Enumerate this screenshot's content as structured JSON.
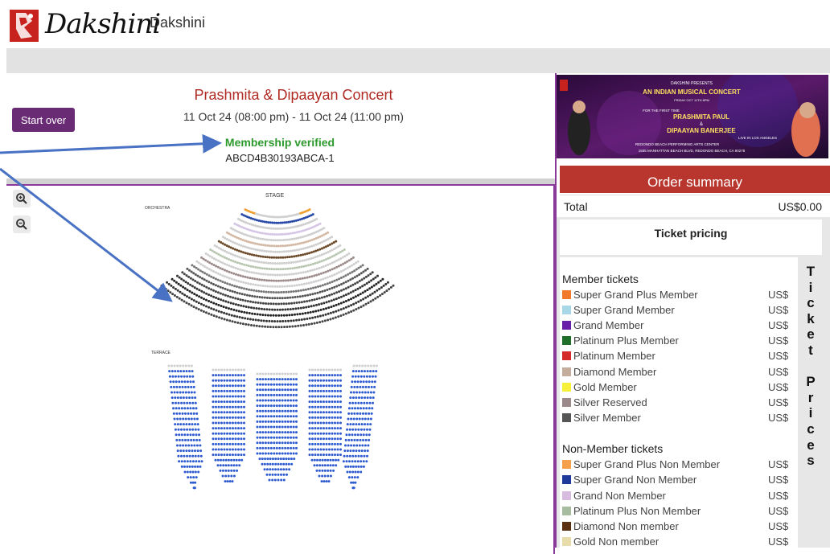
{
  "header": {
    "logo_word": "Dakshini",
    "site_name": "Dakshini"
  },
  "event": {
    "start_over_label": "Start over",
    "title": "Prashmita & Dipaayan Concert",
    "dates": "11 Oct 24 (08:00 pm) - 11 Oct 24 (11:00 pm)",
    "membership_status": "Membership verified",
    "membership_code": "ABCD4B30193ABCA-1"
  },
  "seatmap": {
    "stage_label": "STAGE",
    "orchestra_label": "ORCHESTRA",
    "terrace_label": "TERRACE",
    "icons": {
      "zoom_in": "zoom-in-icon",
      "zoom_out": "zoom-out-icon"
    }
  },
  "banner": {
    "presents": "DAKSHINI PRESENTS",
    "headline": "AN INDIAN MUSICAL CONCERT",
    "date_line": "FRIDAY OCT 11TH 8PM",
    "first_time": "FOR THE FIRST TIME",
    "artist1": "PRASHMITA PAUL",
    "amp": "&",
    "artist2": "DIPAAYAN BANERJEE",
    "live": "LIVE IN LOS ANGELES",
    "venue": "REDONDO BEACH PERFORMING ARTS CENTER",
    "address": "1935 MANHATTAN BEACH BLVD, REDONDO BEACH, CA 90278"
  },
  "summary": {
    "title": "Order summary",
    "total_label": "Total",
    "total_value": "US$0.00"
  },
  "pricing": {
    "title": "Ticket pricing",
    "vertical_label": [
      "T",
      "i",
      "c",
      "k",
      "e",
      "t",
      " ",
      "P",
      "r",
      "i",
      "c",
      "e",
      "s"
    ],
    "groups": [
      {
        "title": "Member tickets",
        "tiers": [
          {
            "name": "Super Grand Plus Member",
            "currency": "US$",
            "color": "#f07a2a"
          },
          {
            "name": "Super Grand Member",
            "currency": "US$",
            "color": "#a8d8e8"
          },
          {
            "name": "Grand Member",
            "currency": "US$",
            "color": "#6a1fa8"
          },
          {
            "name": "Platinum Plus Member",
            "currency": "US$",
            "color": "#1f6e2a"
          },
          {
            "name": "Platinum Member",
            "currency": "US$",
            "color": "#d42a2a"
          },
          {
            "name": "Diamond Member",
            "currency": "US$",
            "color": "#c4ad9c"
          },
          {
            "name": "Gold Member",
            "currency": "US$",
            "color": "#f7f03a"
          },
          {
            "name": "Silver Reserved",
            "currency": "US$",
            "color": "#9c8a8a"
          },
          {
            "name": "Silver Member",
            "currency": "US$",
            "color": "#555555"
          }
        ]
      },
      {
        "title": "Non-Member tickets",
        "tiers": [
          {
            "name": "Super Grand Plus Non Member",
            "currency": "US$",
            "color": "#f5a04a"
          },
          {
            "name": "Super Grand Non Member",
            "currency": "US$",
            "color": "#1f3a9a"
          },
          {
            "name": "Grand Non Member",
            "currency": "US$",
            "color": "#d8bce0"
          },
          {
            "name": "Platinum Plus Non Member",
            "currency": "US$",
            "color": "#a8bca0"
          },
          {
            "name": "Diamond Non member",
            "currency": "US$",
            "color": "#5a3010"
          },
          {
            "name": "Gold Non member",
            "currency": "US$",
            "color": "#e8dcaa"
          }
        ]
      }
    ]
  }
}
